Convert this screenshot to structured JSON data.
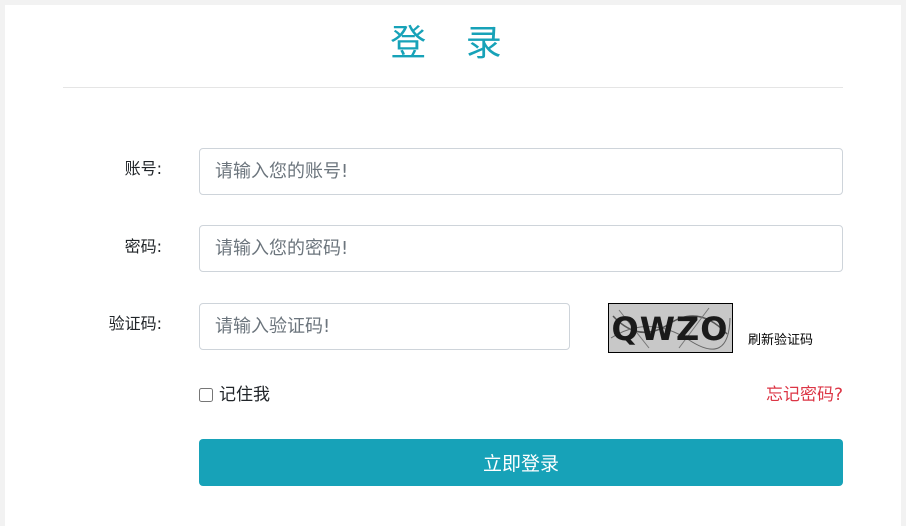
{
  "title": "登 录",
  "form": {
    "account": {
      "label": "账号:",
      "placeholder": "请输入您的账号!"
    },
    "password": {
      "label": "密码:",
      "placeholder": "请输入您的密码!"
    },
    "captcha": {
      "label": "验证码:",
      "placeholder": "请输入验证码!",
      "image_text": "QWZO",
      "refresh_label": "刷新验证码"
    },
    "remember_label": "记住我",
    "remember_checked": false,
    "forgot_label": "忘记密码?",
    "submit_label": "立即登录"
  },
  "colors": {
    "accent": "#17a2b8",
    "danger": "#dc3545"
  }
}
